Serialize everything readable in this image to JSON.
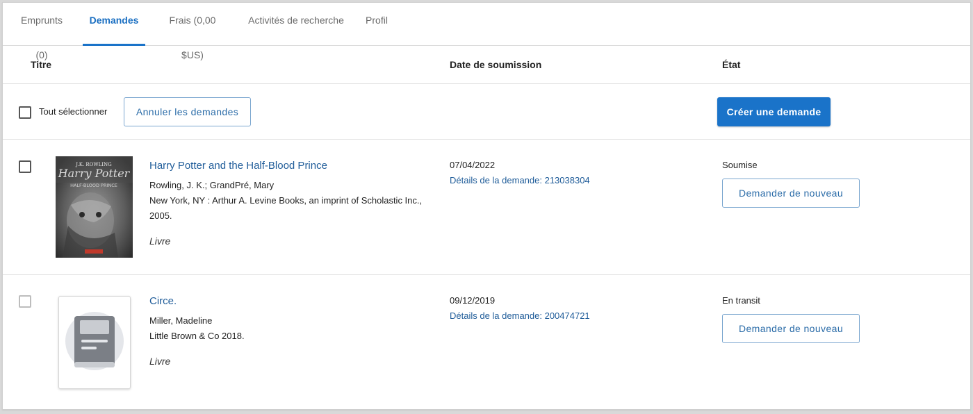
{
  "tabs": [
    {
      "label": "Emprunts (0)",
      "active": false
    },
    {
      "label": "Demandes",
      "active": true
    },
    {
      "label": "Frais (0,00 $US)",
      "active": false
    },
    {
      "label": "Activités de recherche",
      "active": false
    },
    {
      "label": "Profil",
      "active": false
    }
  ],
  "table": {
    "headers": {
      "title": "Titre",
      "date": "Date de soumission",
      "state": "État"
    },
    "select_all_label": "Tout sélectionner",
    "cancel_button": "Annuler les demandes",
    "create_button": "Créer une demande"
  },
  "requests": [
    {
      "title": "Harry Potter and the Half-Blood Prince",
      "authors": "Rowling, J. K.; GrandPré, Mary",
      "publisher": "New York, NY : Arthur A. Levine Books, an imprint of Scholastic Inc., 2005.",
      "type": "Livre",
      "date": "07/04/2022",
      "details": "Détails de la demande: 213038304",
      "status": "Soumise",
      "action": "Demander de nouveau",
      "cover": "book-cover-image"
    },
    {
      "title": "Circe.",
      "authors": "Miller, Madeline",
      "publisher": "Little Brown & Co 2018.",
      "type": "Livre",
      "date": "09/12/2019",
      "details": "Détails de la demande: 200474721",
      "status": "En transit",
      "action": "Demander de nouveau",
      "cover": "generic-book-icon"
    }
  ],
  "colors": {
    "accent": "#1a73c9",
    "link": "#1f5c99",
    "border": "#e2e2e2"
  }
}
